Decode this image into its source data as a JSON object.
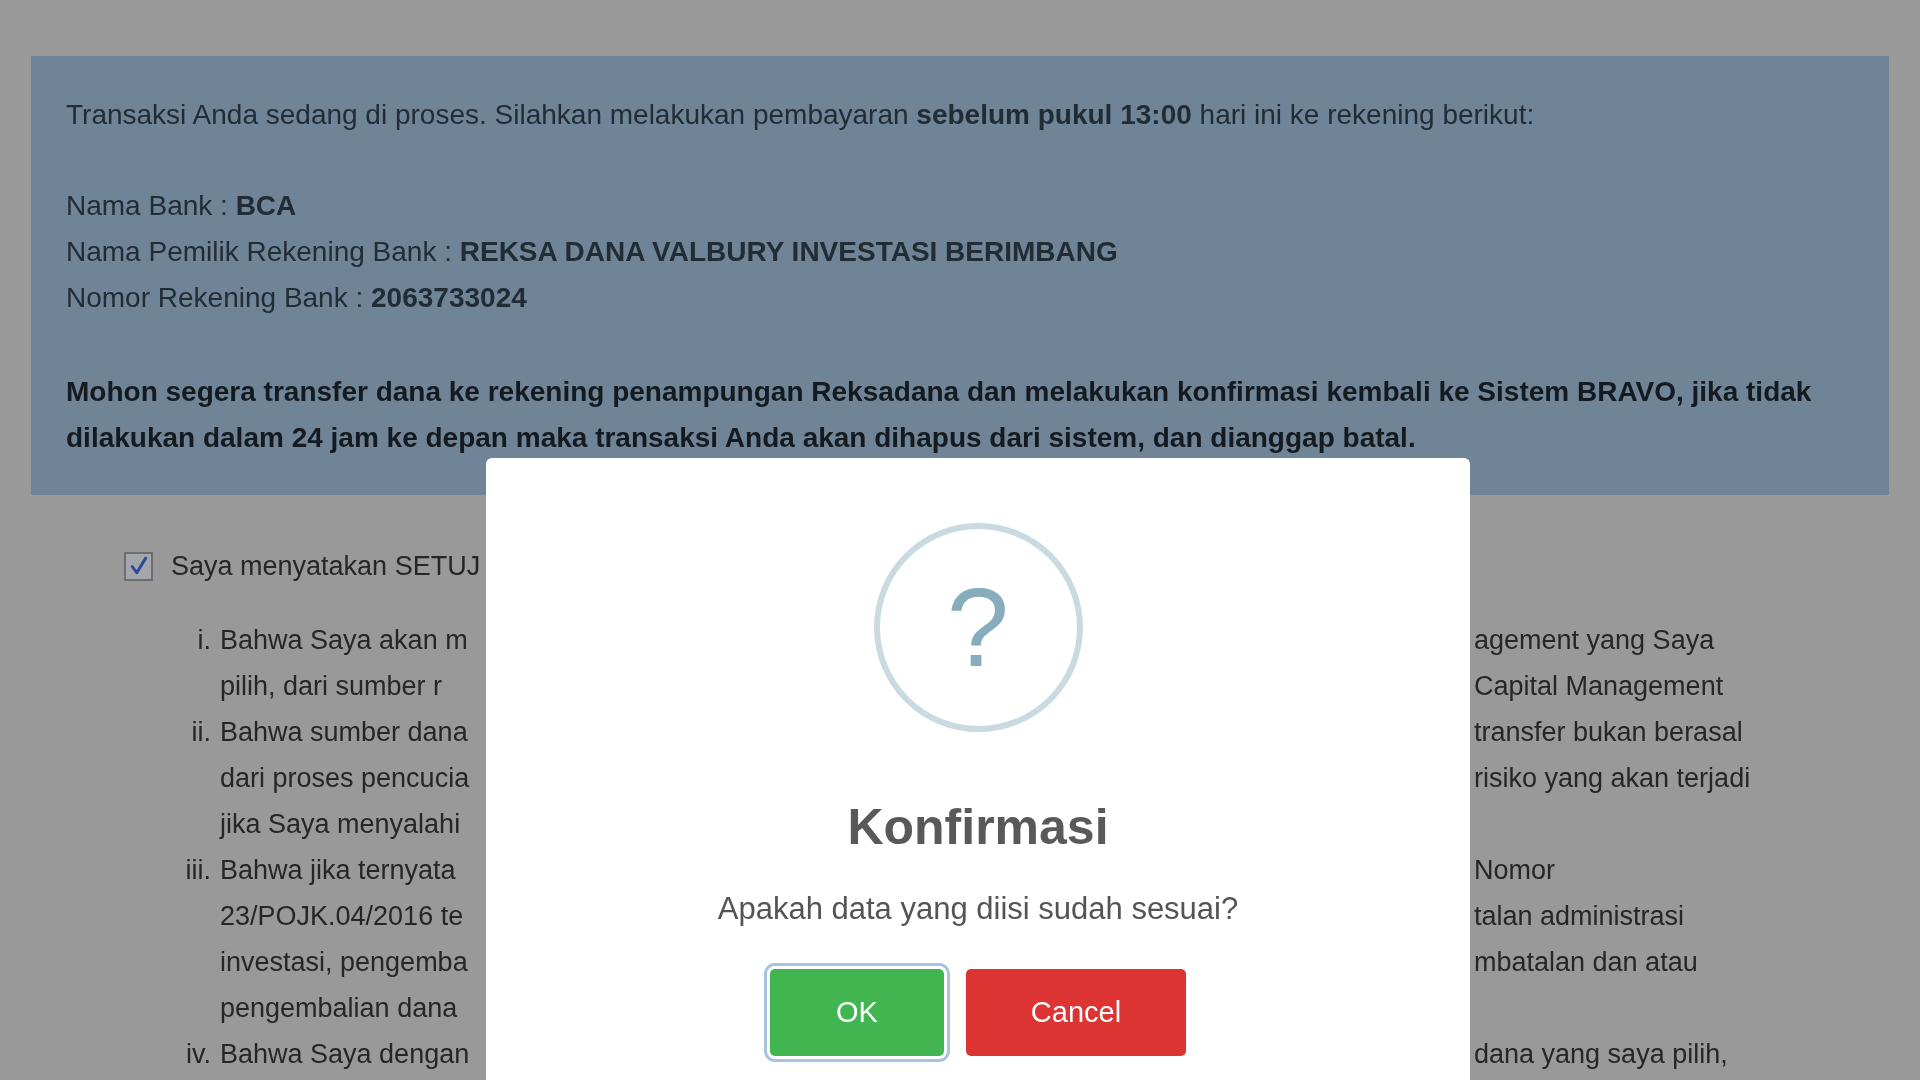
{
  "payment_notice": {
    "intro": "Transaksi Anda sedang di proses. Silahkan melakukan pembayaran **sebelum pukul 13:00** hari ini ke rekening berikut:",
    "details": [
      "Nama Bank : **BCA**",
      "Nama Pemilik Rekening Bank : **REKSA DANA VALBURY INVESTASI BERIMBANG**",
      "Nomor Rekening Bank : **2063733024**"
    ],
    "warning": "Mohon segera transfer dana ke rekening penampungan Reksadana dan melakukan konfirmasi kembali ke Sistem BRAVO, jika tidak dilakukan dalam 24 jam ke depan maka transaksi Anda akan dihapus dari sistem, dan dianggap batal."
  },
  "agreement": {
    "checked": true,
    "label": "Saya menyatakan SETUJ",
    "statements": [
      {
        "numeral": "i.",
        "lines": [
          {
            "left": "Bahwa Saya akan m",
            "right": "agement yang Saya"
          },
          {
            "left": "pilih, dari sumber r",
            "right": "Capital Management"
          }
        ]
      },
      {
        "numeral": "ii.",
        "lines": [
          {
            "left": "Bahwa sumber dana",
            "right": "transfer bukan berasal"
          },
          {
            "left": "dari proses pencucia",
            "right": "risiko yang akan terjadi"
          },
          {
            "left": "jika Saya menyalahi"
          }
        ]
      },
      {
        "numeral": "iii.",
        "lines": [
          {
            "left": "Bahwa jika ternyata",
            "right": "Nomor"
          },
          {
            "left": "23/POJK.04/2016 te",
            "right": "talan administrasi"
          },
          {
            "left": "investasi, pengemba",
            "right": "mbatalan dan atau"
          },
          {
            "left": "pengembalian dana"
          }
        ]
      },
      {
        "numeral": "iv.",
        "lines": [
          {
            "left": "Bahwa Saya dengan",
            "right": "dana yang saya pilih,"
          }
        ]
      }
    ]
  },
  "dialog": {
    "icon": "?",
    "title": "Konfirmasi",
    "message": "Apakah data yang diisi sudah sesuai?",
    "buttons": [
      {
        "kind": "confirm",
        "label": "OK",
        "focused": true
      },
      {
        "kind": "cancel",
        "label": "Cancel",
        "focused": false
      }
    ]
  }
}
